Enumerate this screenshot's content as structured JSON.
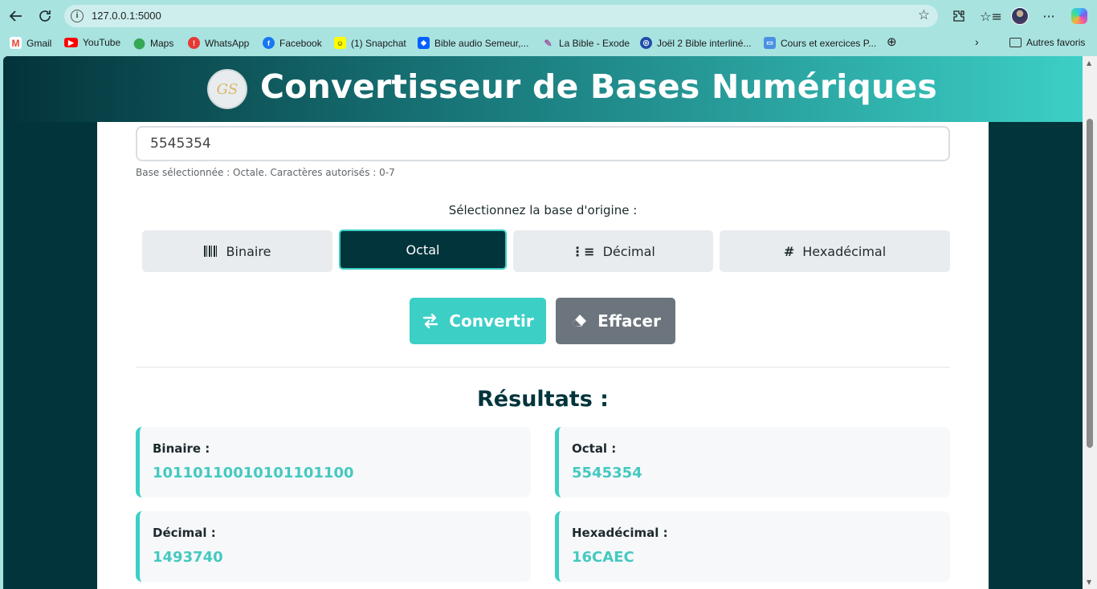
{
  "browser": {
    "url": "127.0.0.1:5000",
    "bookmarks": [
      {
        "label": "Gmail",
        "icon": "gmail-icon",
        "color": "#ea4335"
      },
      {
        "label": "YouTube",
        "icon": "youtube-icon",
        "color": "#ff0000"
      },
      {
        "label": "Maps",
        "icon": "maps-icon",
        "color": "#34a853"
      },
      {
        "label": "WhatsApp",
        "icon": "whatsapp-icon",
        "color": "#e53935"
      },
      {
        "label": "Facebook",
        "icon": "facebook-icon",
        "color": "#1877f2"
      },
      {
        "label": "(1) Snapchat",
        "icon": "snapchat-icon",
        "color": "#fffc00"
      },
      {
        "label": "Bible audio Semeur,...",
        "icon": "dropbox-icon",
        "color": "#0061ff"
      },
      {
        "label": "La Bible - Exode",
        "icon": "bible-icon",
        "color": "#9c5aa0"
      },
      {
        "label": "Joël 2 Bible interliné...",
        "icon": "bible-globe-icon",
        "color": "#1e4ea8"
      },
      {
        "label": "Cours et exercices P...",
        "icon": "course-icon",
        "color": "#4a90e2"
      }
    ],
    "other_favorites": "Autres favoris"
  },
  "app": {
    "title": "Convertisseur de Bases Numériques",
    "logo_text": "GS",
    "input_value": "5545354",
    "hint": "Base sélectionnée : Octale. Caractères autorisés : 0-7",
    "select_label": "Sélectionnez la base d'origine :",
    "bases": {
      "binary": "Binaire",
      "octal": "Octal",
      "decimal": "Décimal",
      "hex": "Hexadécimal"
    },
    "convert_label": "Convertir",
    "clear_label": "Effacer",
    "results_title": "Résultats :",
    "results": {
      "binary_label": "Binaire :",
      "binary_value": "10110110010101101100",
      "octal_label": "Octal :",
      "octal_value": "5545354",
      "decimal_label": "Décimal :",
      "decimal_value": "1493740",
      "hex_label": "Hexadécimal :",
      "hex_value": "16CAEC"
    }
  },
  "colors": {
    "primary_dark": "#02343b",
    "accent": "#3ccfc6",
    "secondary": "#6c757d"
  }
}
